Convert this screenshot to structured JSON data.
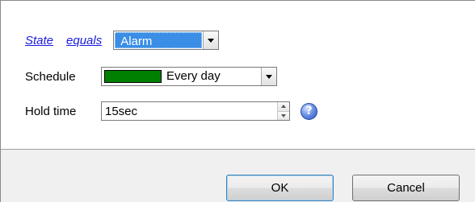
{
  "condition": {
    "field_link": "State",
    "operator_link": "equals",
    "value": "Alarm"
  },
  "schedule": {
    "label": "Schedule",
    "swatch_color": "#008000",
    "value": "Every day"
  },
  "hold_time": {
    "label": "Hold time",
    "value": "15sec",
    "help_glyph": "?"
  },
  "buttons": {
    "ok_label": "OK",
    "cancel_label": "Cancel"
  },
  "icons": {
    "dropdown": "chevron-down-icon",
    "help": "help-icon",
    "spin": "spin-arrows-icon"
  }
}
